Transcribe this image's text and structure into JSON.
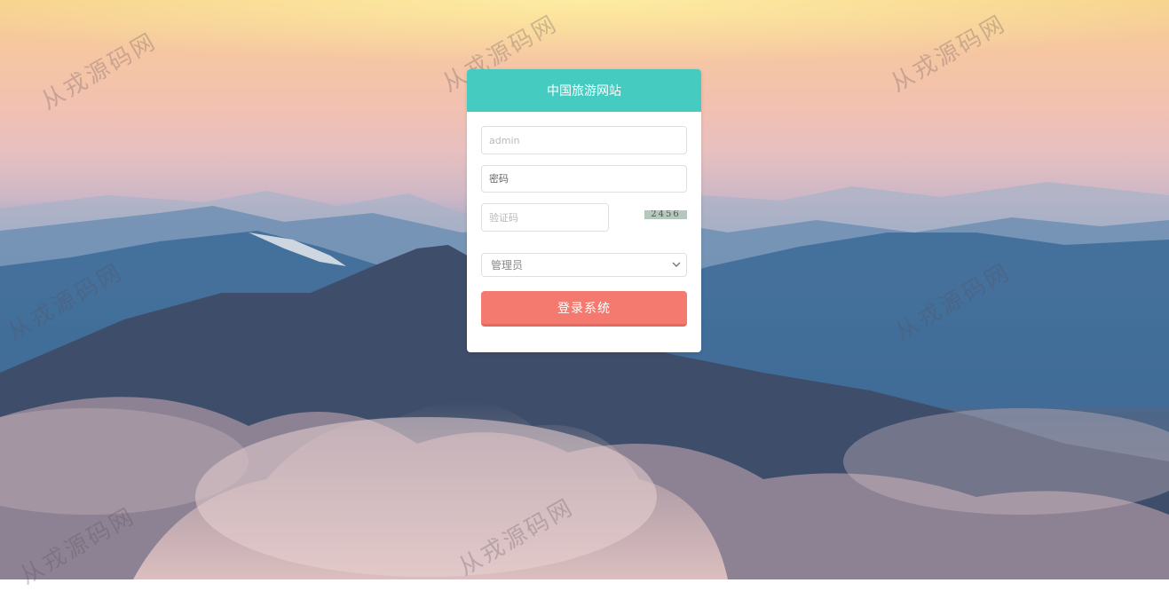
{
  "page": {
    "background": "mountain-sunrise",
    "watermark_text": "从戎源码网"
  },
  "login_card": {
    "title": "中国旅游网站",
    "username": {
      "value": "",
      "placeholder": "admin"
    },
    "password": {
      "value": "",
      "placeholder": "密码"
    },
    "captcha_input": {
      "value": "",
      "placeholder": "验证码"
    },
    "captcha_image_text": "2456",
    "role_select": {
      "selected": "管理员"
    },
    "submit_label": "登录系统"
  },
  "colors": {
    "header": "#46cbc0",
    "button": "#f47a70"
  }
}
